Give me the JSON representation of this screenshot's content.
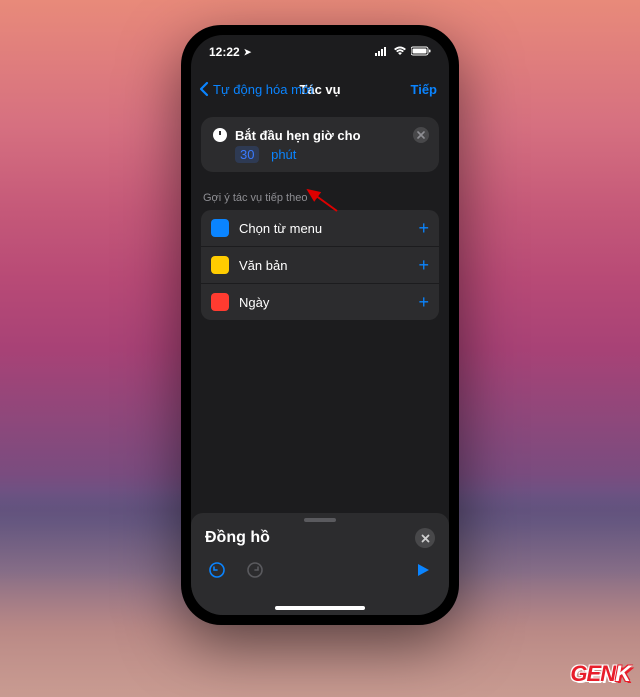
{
  "statusBar": {
    "time": "12:22",
    "locationGlyph": "➤"
  },
  "nav": {
    "back": "Tự động hóa mới",
    "title": "Tác vụ",
    "next": "Tiếp"
  },
  "actionCard": {
    "prefix": "Bắt đầu hẹn giờ cho",
    "value": "30",
    "unit": "phút"
  },
  "sectionHeader": "Gợi ý tác vụ tiếp theo",
  "suggestions": [
    {
      "icon": "menu",
      "label": "Chọn từ menu"
    },
    {
      "icon": "text",
      "label": "Văn bản"
    },
    {
      "icon": "date",
      "label": "Ngày"
    }
  ],
  "drawer": {
    "title": "Đồng hồ"
  },
  "branding": {
    "part1": "GEN",
    "part2": "K"
  }
}
